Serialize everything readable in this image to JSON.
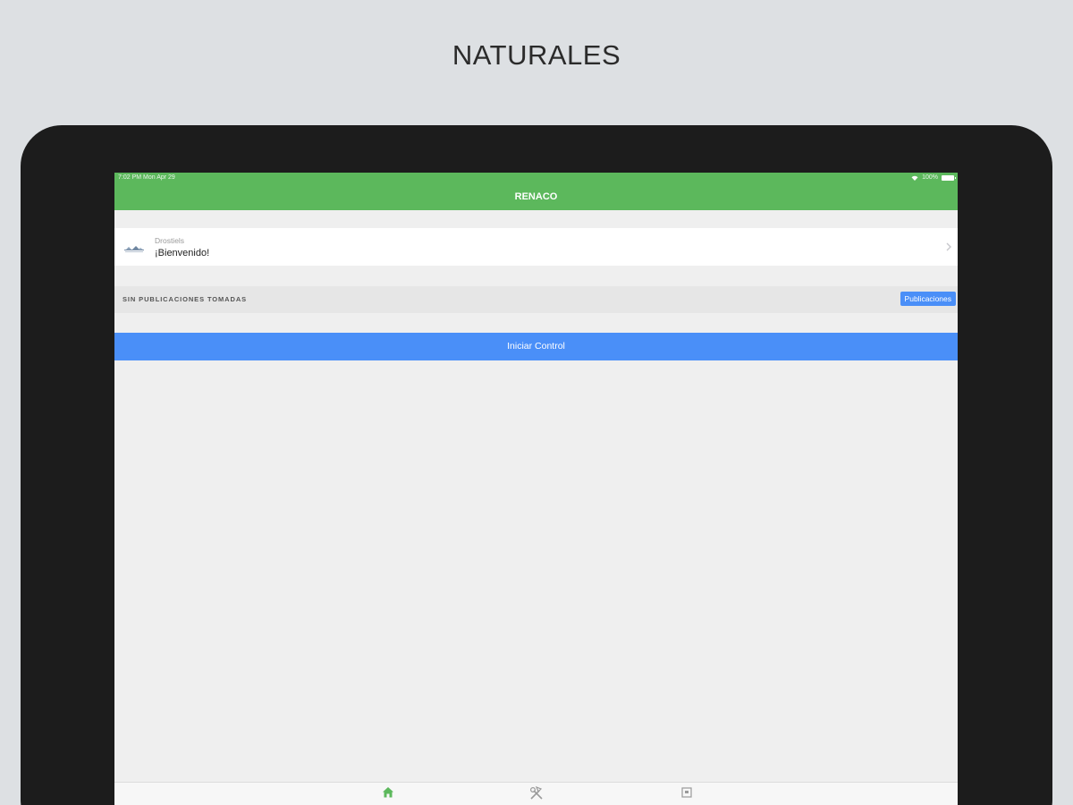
{
  "headline": "NATURALES",
  "status_bar": {
    "time_date": "7:02 PM  Mon Apr 29",
    "battery": "100%"
  },
  "nav_bar": {
    "title": "RENACO"
  },
  "user_row": {
    "subtitle": "Drostiels",
    "title": "¡Bienvenido!"
  },
  "section": {
    "label": "SIN PUBLICACIONES TOMADAS",
    "button_label": "Publicaciones"
  },
  "start_button": {
    "label": "Iniciar Control"
  },
  "tab_bar": {
    "tabs": [
      {
        "icon": "home-icon",
        "active": true
      },
      {
        "icon": "tools-icon",
        "active": false
      },
      {
        "icon": "document-icon",
        "active": false
      }
    ]
  },
  "colors": {
    "accent_green": "#5cb85c",
    "accent_blue": "#4a8ff8",
    "background": "#dde0e3",
    "device": "#1c1c1c"
  }
}
